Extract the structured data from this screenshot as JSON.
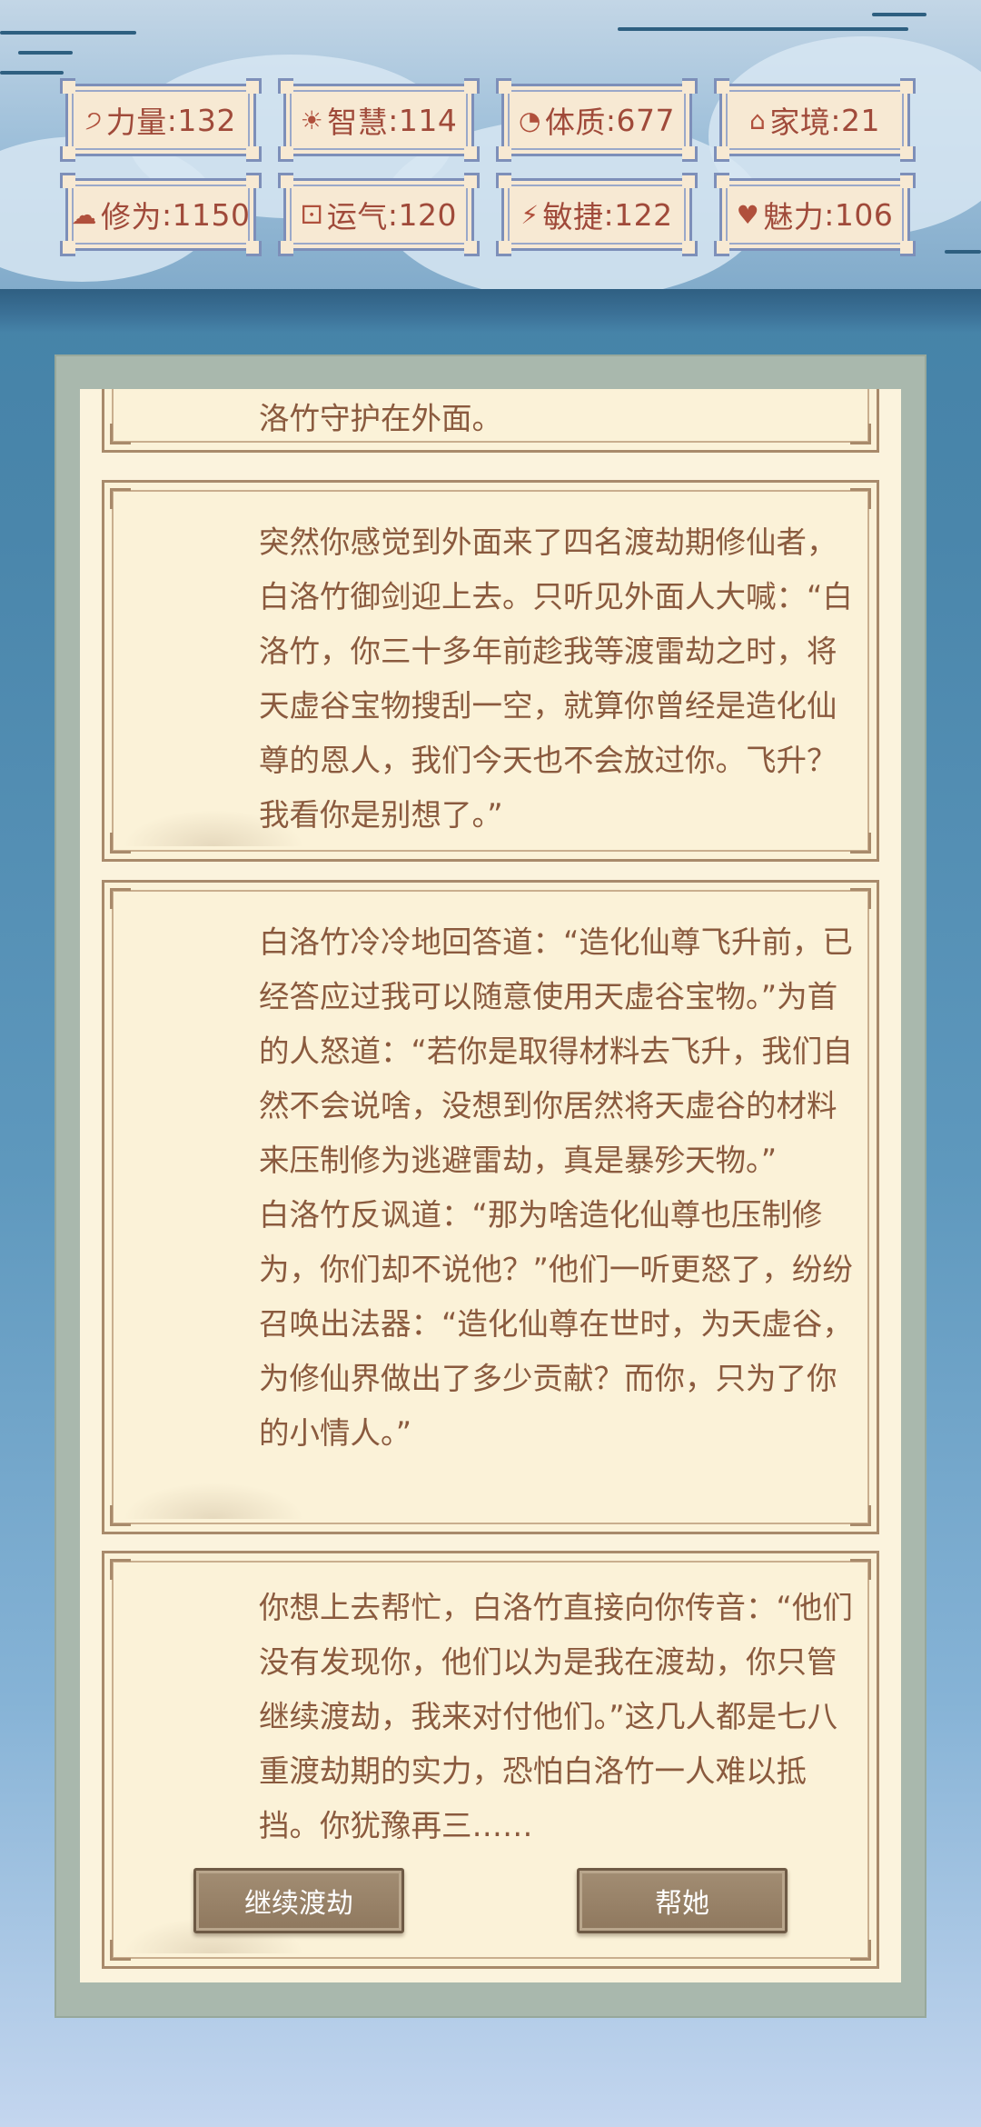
{
  "stats": [
    {
      "icon": "bicep-icon",
      "glyph": "੭",
      "label": "力量",
      "value": "132"
    },
    {
      "icon": "lightbulb-icon",
      "glyph": "☀",
      "label": "智慧",
      "value": "114"
    },
    {
      "icon": "target-icon",
      "glyph": "◔",
      "label": "体质",
      "value": "677"
    },
    {
      "icon": "home-icon",
      "glyph": "⌂",
      "label": "家境",
      "value": " 21"
    },
    {
      "icon": "cloud-icon",
      "glyph": "☁",
      "label": "修为",
      "value": "1150"
    },
    {
      "icon": "dice-icon",
      "glyph": "⚀",
      "label": "运气",
      "value": "120"
    },
    {
      "icon": "lightning-icon",
      "glyph": "⚡",
      "label": "敏捷",
      "value": "122"
    },
    {
      "icon": "heart-icon",
      "glyph": "♥",
      "label": "魅力",
      "value": "106"
    }
  ],
  "story": {
    "partial_line": "洛竹守护在外面。",
    "card2": "突然你感觉到外面来了四名渡劫期修仙者，白洛竹御剑迎上去。只听见外面人大喊：“白洛竹，你三十多年前趁我等渡雷劫之时，将天虚谷宝物搜刮一空，就算你曾经是造化仙尊的恩人，我们今天也不会放过你。飞升？我看你是别想了。”",
    "card3": "白洛竹冷冷地回答道：“造化仙尊飞升前，已经答应过我可以随意使用天虚谷宝物。”为首的人怒道：“若你是取得材料去飞升，我们自然不会说啥，没想到你居然将天虚谷的材料来压制修为逃避雷劫，真是暴殄天物。”\n白洛竹反讽道：“那为啥造化仙尊也压制修为，你们却不说他？”他们一听更怒了，纷纷召唤出法器：“造化仙尊在世时，为天虚谷，为修仙界做出了多少贡献？而你，只为了你的小情人。”",
    "card4": "你想上去帮忙，白洛竹直接向你传音：“他们没有发现你，他们以为是我在渡劫，你只管继续渡劫，我来对付他们。”这几人都是七八重渡劫期的实力，恐怕白洛竹一人难以抵挡。你犹豫再三……"
  },
  "choices": {
    "continue_label": "继续渡劫",
    "help_label": "帮她"
  }
}
